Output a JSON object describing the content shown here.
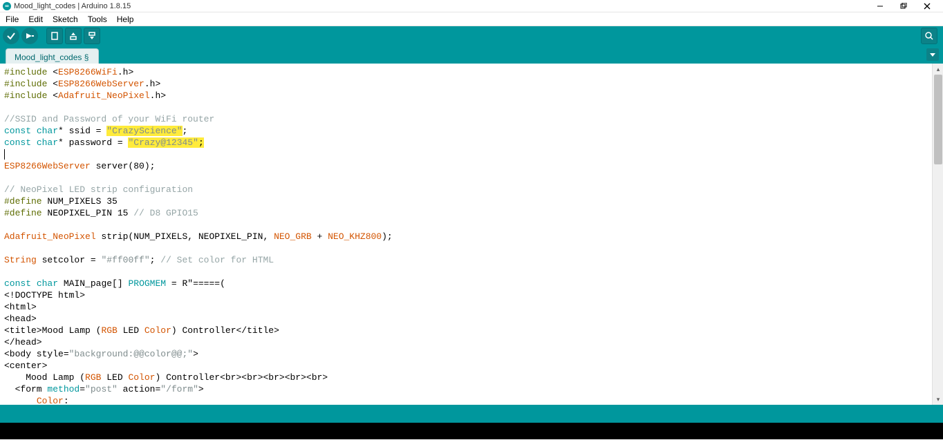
{
  "title": "Mood_light_codes | Arduino 1.8.15",
  "menus": [
    "File",
    "Edit",
    "Sketch",
    "Tools",
    "Help"
  ],
  "tab": {
    "label": "Mood_light_codes §"
  },
  "code": {
    "inc1_key": "#include",
    "inc1_lib": "ESP8266WiFi",
    "inc1_ext": ".h",
    "inc2_key": "#include",
    "inc2_lib": "ESP8266WebServer",
    "inc2_ext": ".h",
    "inc3_key": "#include",
    "inc3_lib": "Adafruit_NeoPixel",
    "inc3_ext": ".h",
    "com1": "//SSID and Password of your WiFi router",
    "const": "const",
    "char": "char",
    "var_ssid": " ssid = ",
    "ssid_q1": "\"",
    "ssid_val": "CrazyScience",
    "ssid_q2": "\"",
    "semi": ";",
    "var_pw": " password = ",
    "pw_q1": "\"",
    "pw_val": "Crazy@12345",
    "pw_q2": "\"",
    "ws_type": "ESP8266WebServer",
    "ws_rest": " server(80);",
    "com2": "// NeoPixel LED strip configuration",
    "def": "#define",
    "def1_name": " NUM_PIXELS 35",
    "def2_name": " NEOPIXEL_PIN 15 ",
    "def2_com": "// D8 GPIO15",
    "np_type": "Adafruit_NeoPixel",
    "np_rest_a": " strip(NUM_PIXELS, NEOPIXEL_PIN, ",
    "np_grb": "NEO_GRB",
    "np_plus": " + ",
    "np_khz": "NEO_KHZ800",
    "np_rest_b": ");",
    "string": "String",
    "setcolor_a": " setcolor = ",
    "setcolor_q": "\"#ff00ff\"",
    "setcolor_b": "; ",
    "setcolor_com": "// Set color for HTML",
    "mp_a": "const",
    "mp_b": "char",
    "mp_c": " MAIN_page[] ",
    "mp_d": "PROGMEM",
    "mp_e": " = R\"=====(",
    "l1": "<!DOCTYPE html>",
    "l2": "<html>",
    "l3": "<head>",
    "l4_a": "<title>Mood Lamp (",
    "l4_b": "RGB",
    "l4_c": " LED ",
    "l4_d": "Color",
    "l4_e": ") Controller</title>",
    "l5": "</head>",
    "l6_a": "<body style=",
    "l6_b": "\"background:@@color@@;\"",
    "l6_c": ">",
    "l7": "<center>",
    "l8_a": "    Mood Lamp (",
    "l8_b": "RGB",
    "l8_c": " LED ",
    "l8_d": "Color",
    "l8_e": ") Controller<br><br><br><br><br>",
    "l9_a": "  <form ",
    "l9_b": "method",
    "l9_c": "=",
    "l9_d": "\"post\"",
    "l9_e": " action=",
    "l9_f": "\"/form\"",
    "l9_g": ">",
    "l10_a": "      ",
    "l10_b": "Color",
    "l10_c": ":"
  }
}
